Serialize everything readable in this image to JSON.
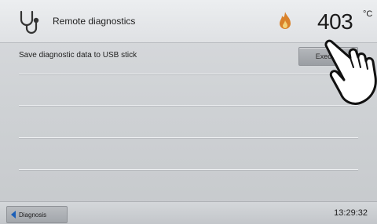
{
  "header": {
    "title": "Remote diagnostics",
    "temperature": "403",
    "temperature_unit": "°C",
    "icon": "stethoscope-icon",
    "status_icon": "flame-icon"
  },
  "rows": [
    {
      "label": "Save diagnostic data to USB stick",
      "button_label": "Execute"
    }
  ],
  "footer": {
    "back_label": "Diagnosis",
    "back_icon": "back-arrow-icon",
    "time": "13:29:32"
  },
  "colors": {
    "accent": "#1b5fb8",
    "flame": "#d9822b"
  }
}
